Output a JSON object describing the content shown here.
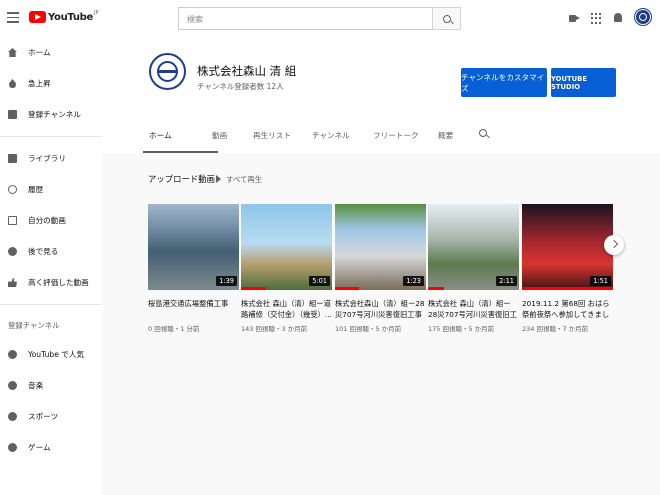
{
  "topbar": {
    "logo_text": "YouTube",
    "logo_region": "JP",
    "search_placeholder": "検索"
  },
  "sidebar": {
    "main": [
      {
        "label": "ホーム",
        "icon": "home-icon"
      },
      {
        "label": "急上昇",
        "icon": "fire-icon"
      },
      {
        "label": "登録チャンネル",
        "icon": "subscriptions-icon"
      }
    ],
    "library": [
      {
        "label": "ライブラリ",
        "icon": "library-icon"
      },
      {
        "label": "履歴",
        "icon": "history-icon"
      },
      {
        "label": "自分の動画",
        "icon": "your-videos-icon"
      },
      {
        "label": "後で見る",
        "icon": "watch-later-icon"
      },
      {
        "label": "高く評価した動画",
        "icon": "thumbs-up-icon"
      }
    ],
    "subscriptions_heading": "登録チャンネル",
    "subscriptions": [
      {
        "label": "YouTube で人気",
        "icon": "popular-icon"
      },
      {
        "label": "音楽",
        "icon": "music-icon"
      },
      {
        "label": "スポーツ",
        "icon": "sports-icon"
      },
      {
        "label": "ゲーム",
        "icon": "gaming-icon"
      }
    ]
  },
  "channel": {
    "name": "株式会社森山 清 組",
    "subscribers": "チャンネル登録者数 12人",
    "customize_label": "チャンネルをカスタマイズ",
    "studio_label": "YOUTUBE STUDIO",
    "tabs": [
      "ホーム",
      "動画",
      "再生リスト",
      "チャンネル",
      "フリートーク",
      "概要"
    ]
  },
  "shelf": {
    "title": "アップロード動画",
    "play_all": "すべて再生",
    "videos": [
      {
        "title": "桜島港交通広場整備工事",
        "meta": "0 回視聴・1 分前",
        "duration": "1:39",
        "progress": 0
      },
      {
        "title": "株式会社 森山（清）組ー道路補修（交付金）（幾受）...",
        "meta": "143 回視聴・3 か月前",
        "duration": "5:01",
        "progress": 0.28
      },
      {
        "title": "株式会社森山（清）組ー28災707号河川災害復旧工事（...",
        "meta": "101 回視聴・5 か月前",
        "duration": "1:23",
        "progress": 0.26
      },
      {
        "title": "株式会社 森山（清）組ー28災707号河川災害復旧工事...",
        "meta": "175 回視聴・5 か月前",
        "duration": "2:11",
        "progress": 0.18
      },
      {
        "title": "2019.11.2 第68回 おはら祭前夜祭へ参加してきました",
        "meta": "234 回視聴・7 か月前",
        "duration": "1:51",
        "progress": 1
      }
    ]
  }
}
